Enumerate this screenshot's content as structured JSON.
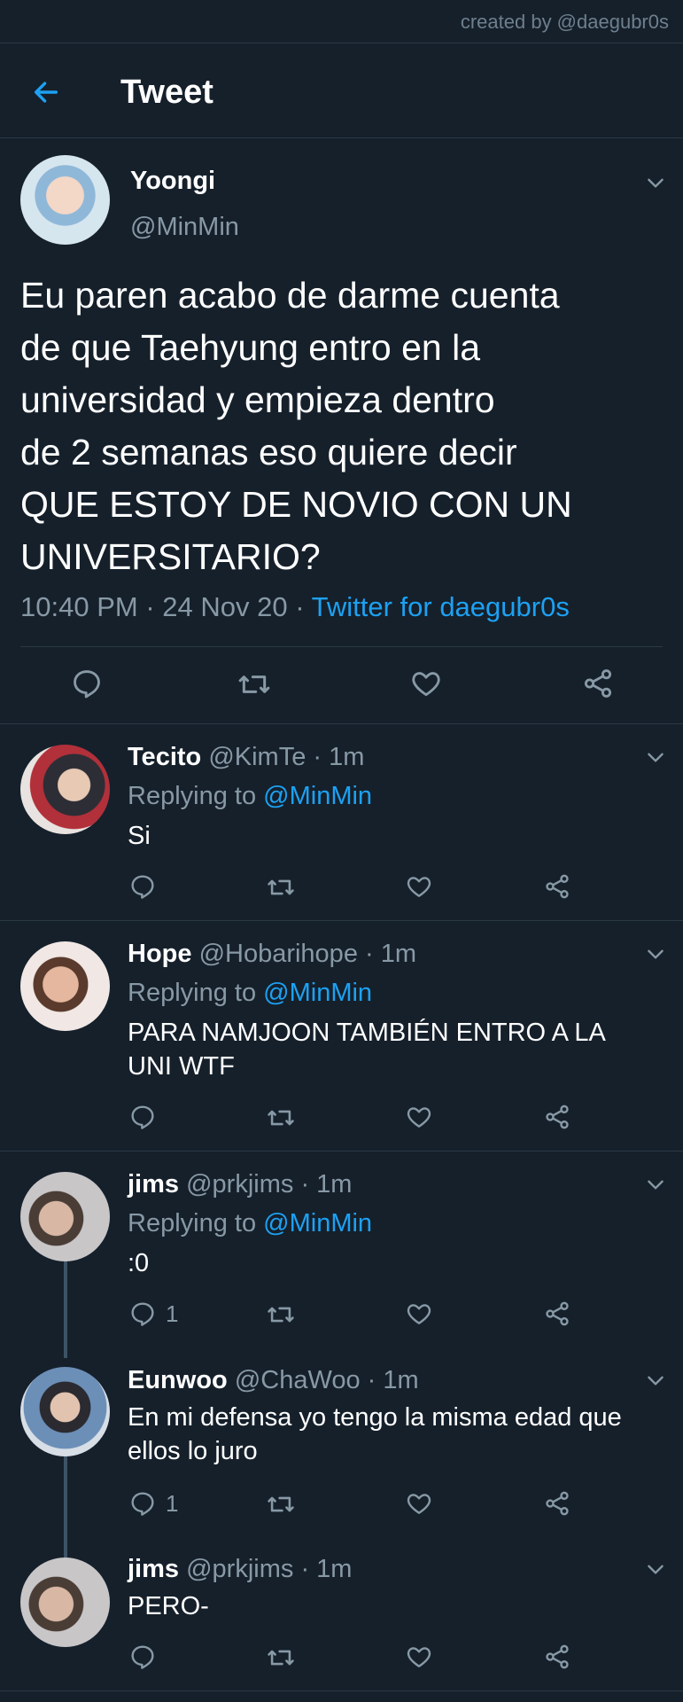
{
  "watermark": "created by @daegubr0s",
  "header": {
    "title": "Tweet"
  },
  "colors": {
    "background": "#15202b",
    "accent": "#1da1f2",
    "muted": "#8899a6",
    "divider": "#2b3945"
  },
  "main_tweet": {
    "name": "Yoongi",
    "handle": "@MinMin",
    "text": "Eu paren acabo de darme cuenta\nde que Taehyung entro en la\nuniversidad y empieza dentro\nde 2 semanas eso quiere decir\nQUE ESTOY DE NOVIO CON UN\nUNIVERSITARIO?",
    "time": "10:40 PM",
    "date": "24 Nov 20",
    "source": "Twitter for daegubr0s"
  },
  "replies": [
    {
      "name": "Tecito",
      "handle": "@KimTe",
      "time": "1m",
      "replying_prefix": "Replying to",
      "replying_to": "@MinMin",
      "text": "Si",
      "reply_count": ""
    },
    {
      "name": "Hope",
      "handle": "@Hobarihope",
      "time": "1m",
      "replying_prefix": "Replying to",
      "replying_to": "@MinMin",
      "text": "PARA NAMJOON TAMBIÉN ENTRO A LA\nUNI WTF",
      "reply_count": ""
    },
    {
      "name": "jims",
      "handle": "@prkjims",
      "time": "1m",
      "replying_prefix": "Replying to",
      "replying_to": "@MinMin",
      "text": ":0",
      "reply_count": "1"
    },
    {
      "name": "Eunwoo",
      "handle": "@ChaWoo",
      "time": "1m",
      "text": "En mi defensa yo tengo la misma edad que\nellos lo juro",
      "reply_count": "1"
    },
    {
      "name": "jims",
      "handle": "@prkjims",
      "time": "1m",
      "text": "PERO-",
      "reply_count": ""
    }
  ],
  "separator": "·",
  "icons": [
    "back-arrow-icon",
    "chevron-down-icon",
    "reply-icon",
    "retweet-icon",
    "like-icon",
    "share-icon"
  ]
}
